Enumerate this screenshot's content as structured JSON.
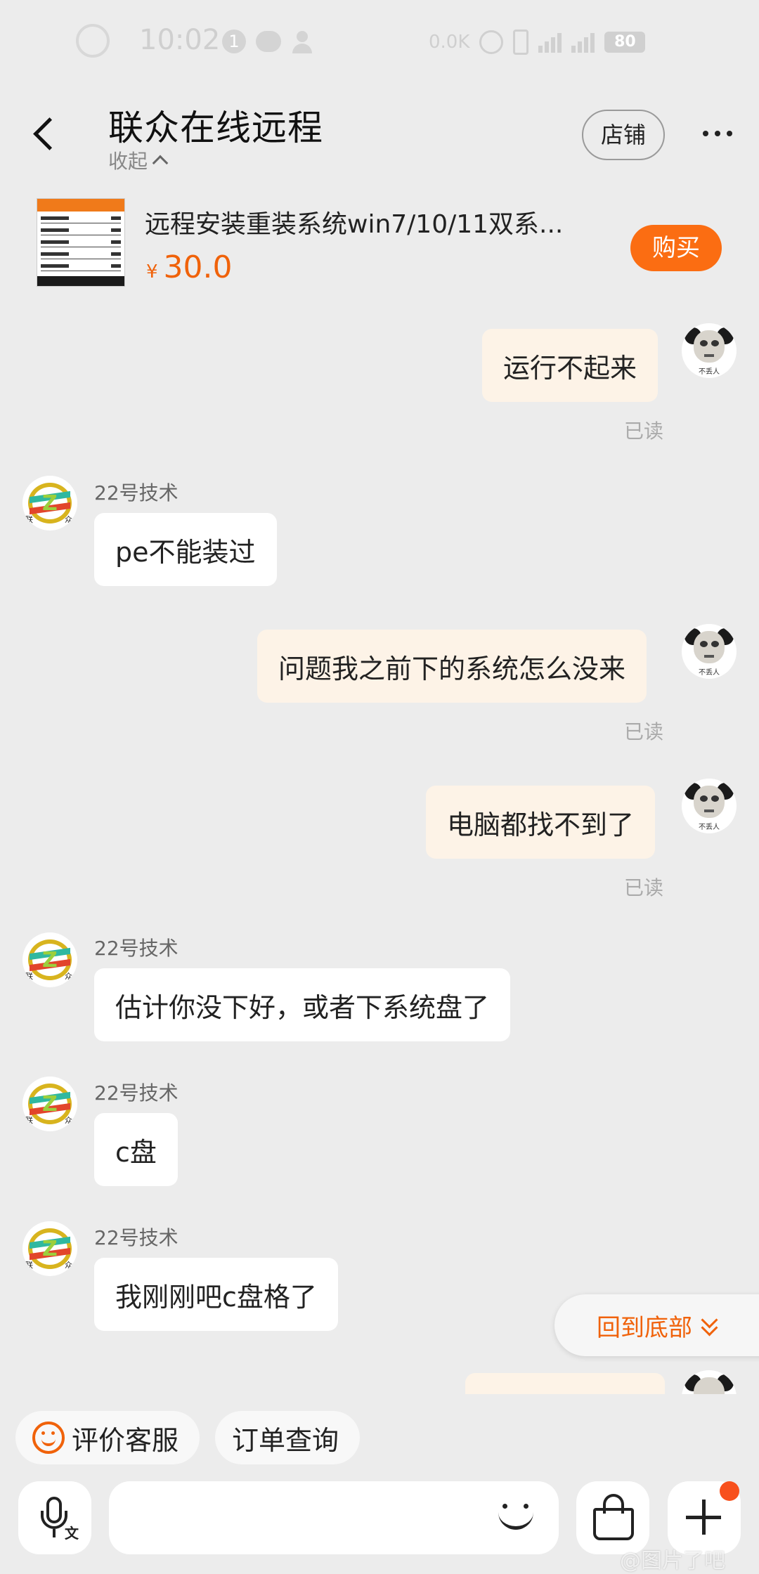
{
  "status_bar": {
    "time": "10:02",
    "notification_count": "1",
    "net_speed": "0.0K",
    "battery": "80"
  },
  "header": {
    "title": "联众在线远程",
    "collapse_label": "收起",
    "store_button": "店铺"
  },
  "product": {
    "title": "远程安装重装系统win7/10/11双系...",
    "currency": "¥",
    "price": "30.0",
    "buy_button": "购买"
  },
  "messages": [
    {
      "side": "me",
      "text": "运行不起来",
      "status": "已读"
    },
    {
      "side": "them",
      "sender": "22号技术",
      "text": "pe不能装过"
    },
    {
      "side": "me",
      "text": "问题我之前下的系统怎么没来",
      "status": "已读"
    },
    {
      "side": "me",
      "text": "电脑都找不到了",
      "status": "已读"
    },
    {
      "side": "them",
      "sender": "22号技术",
      "text": "估计你没下好，或者下系统盘了"
    },
    {
      "side": "them",
      "sender": "22号技术",
      "text": "c盘"
    },
    {
      "side": "them",
      "sender": "22号技术",
      "text": "我刚刚吧c盘格了"
    }
  ],
  "avatars": {
    "me_caption": "不丢人",
    "shop_char_left": "联",
    "shop_char_right": "众"
  },
  "scroll_to_bottom": "回到底部",
  "quick_actions": [
    "评价客服",
    "订单查询"
  ],
  "input": {
    "placeholder": ""
  },
  "mic_label": "文",
  "watermark": "@图片了吧",
  "colors": {
    "accent": "#f0620a",
    "my_bubble": "#fdf3e7",
    "their_bubble": "#ffffff",
    "background": "#ececec"
  }
}
